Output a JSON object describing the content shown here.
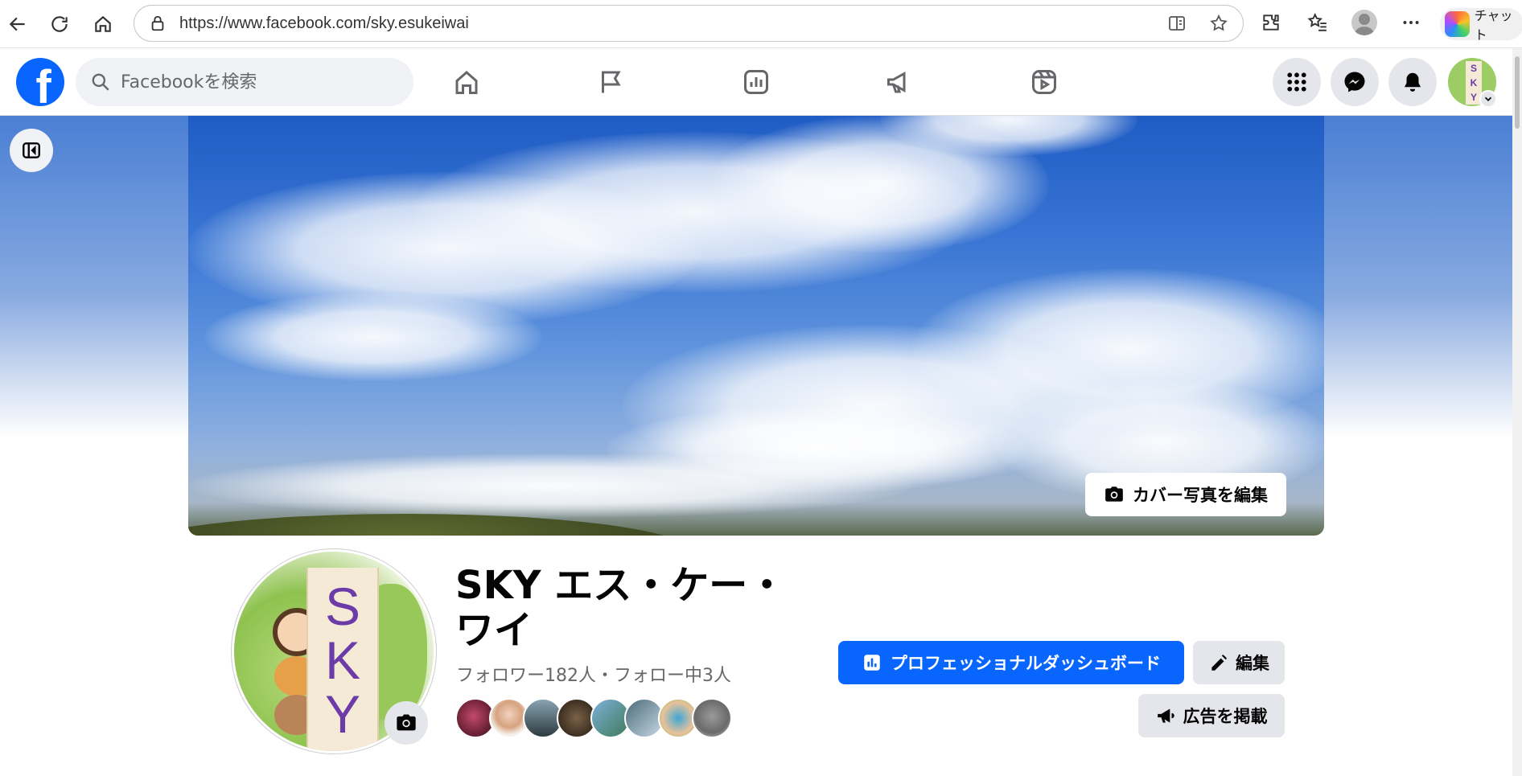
{
  "browser": {
    "url": "https://www.facebook.com/sky.esukeiwai",
    "copilot_label": "チャット"
  },
  "icons": {
    "back": "back-arrow-icon",
    "reload": "reload-icon",
    "home": "home-icon",
    "lock": "lock-icon",
    "split": "split-screen-icon",
    "star": "favorite-star-icon",
    "extensions": "extensions-icon",
    "favorites": "favorites-list-icon",
    "profile": "browser-profile-icon",
    "more": "more-dots-icon"
  },
  "facebook": {
    "logo_letter": "f",
    "search_placeholder": "Facebookを検索",
    "nav_tabs": [
      "home",
      "pages-flag",
      "insights",
      "ads-megaphone",
      "reels"
    ],
    "brand_color": "#0866ff"
  },
  "cover": {
    "edit_label": "カバー写真を編集"
  },
  "profile": {
    "name": "SKY エス・ケー・ワイ",
    "avatar_text": [
      "S",
      "K",
      "Y"
    ],
    "follow_stats": "フォロワー182人・フォロー中3人",
    "followers_shown": 8
  },
  "actions": {
    "dashboard_label": "プロフェッショナルダッシュボード",
    "edit_label": "編集",
    "ad_label": "広告を掲載"
  }
}
